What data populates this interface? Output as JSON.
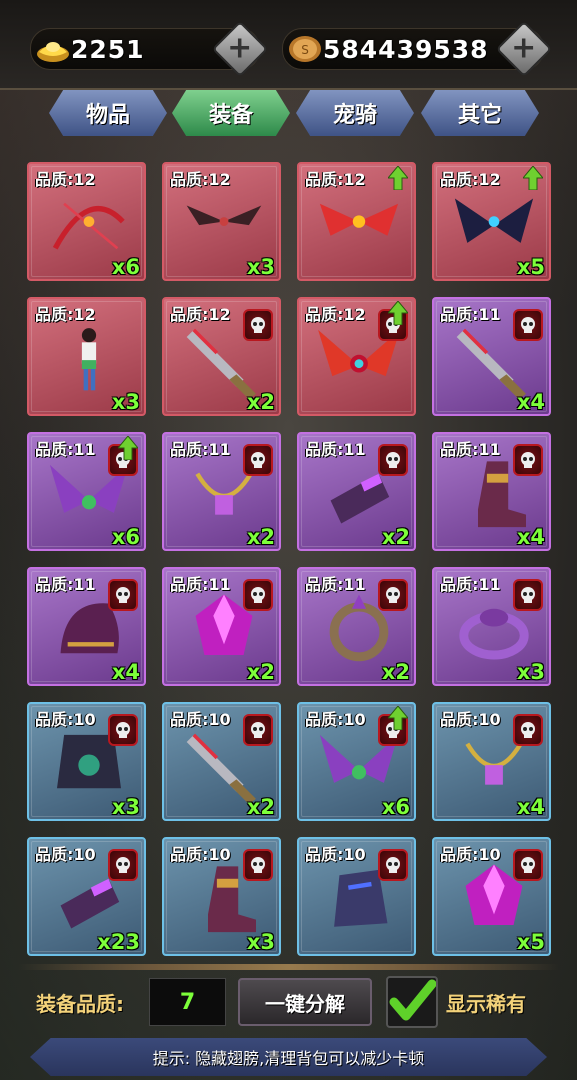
{
  "currency": {
    "gold_value": "2251",
    "coin_value": "584439538",
    "gold_icon": "gold-ingot-icon",
    "coin_icon": "copper-coin-icon",
    "plus_icon": "plus-icon"
  },
  "tabs": [
    {
      "label": "物品",
      "active": false
    },
    {
      "label": "装备",
      "active": true
    },
    {
      "label": "宠骑",
      "active": false
    },
    {
      "label": "其它",
      "active": false
    }
  ],
  "colors": {
    "red_quality": "#b84b59",
    "purple_quality": "#8a52ad",
    "blue_quality": "#4f7490",
    "count_green": "#7dff3a",
    "label_gold": "#f3d27a"
  },
  "items": [
    {
      "quality": "品质:12",
      "count": "x6",
      "rarity": "red",
      "art": "bow",
      "upgrade": false,
      "skull": false
    },
    {
      "quality": "品质:12",
      "count": "x3",
      "rarity": "red",
      "art": "wings-dark",
      "upgrade": false,
      "skull": false
    },
    {
      "quality": "品质:12",
      "count": "",
      "rarity": "red",
      "art": "wings-fire",
      "upgrade": true,
      "skull": false
    },
    {
      "quality": "品质:12",
      "count": "x5",
      "rarity": "red",
      "art": "wings-bat",
      "upgrade": true,
      "skull": false
    },
    {
      "quality": "品质:12",
      "count": "x3",
      "rarity": "red",
      "art": "figure",
      "upgrade": false,
      "skull": false
    },
    {
      "quality": "品质:12",
      "count": "x2",
      "rarity": "red",
      "art": "blade",
      "upgrade": false,
      "skull": true
    },
    {
      "quality": "品质:12",
      "count": "",
      "rarity": "red",
      "art": "wings-phoenix",
      "upgrade": true,
      "skull": true
    },
    {
      "quality": "品质:11",
      "count": "x4",
      "rarity": "purple",
      "art": "blade",
      "upgrade": false,
      "skull": true
    },
    {
      "quality": "品质:11",
      "count": "x6",
      "rarity": "purple",
      "art": "wings-feather",
      "upgrade": true,
      "skull": true
    },
    {
      "quality": "品质:11",
      "count": "x2",
      "rarity": "purple",
      "art": "necklace",
      "upgrade": false,
      "skull": true
    },
    {
      "quality": "品质:11",
      "count": "x2",
      "rarity": "purple",
      "art": "bracer",
      "upgrade": false,
      "skull": true
    },
    {
      "quality": "品质:11",
      "count": "x4",
      "rarity": "purple",
      "art": "boots",
      "upgrade": false,
      "skull": true
    },
    {
      "quality": "品质:11",
      "count": "x4",
      "rarity": "purple",
      "art": "helmet",
      "upgrade": false,
      "skull": true
    },
    {
      "quality": "品质:11",
      "count": "x2",
      "rarity": "purple",
      "art": "gem",
      "upgrade": false,
      "skull": true
    },
    {
      "quality": "品质:11",
      "count": "x2",
      "rarity": "purple",
      "art": "ring-spiked",
      "upgrade": false,
      "skull": true
    },
    {
      "quality": "品质:11",
      "count": "x3",
      "rarity": "purple",
      "art": "ring",
      "upgrade": false,
      "skull": true
    },
    {
      "quality": "品质:10",
      "count": "x3",
      "rarity": "blue",
      "art": "armor",
      "upgrade": false,
      "skull": true
    },
    {
      "quality": "品质:10",
      "count": "x2",
      "rarity": "blue",
      "art": "blade",
      "upgrade": false,
      "skull": true
    },
    {
      "quality": "品质:10",
      "count": "x6",
      "rarity": "blue",
      "art": "wings-feather",
      "upgrade": true,
      "skull": true
    },
    {
      "quality": "品质:10",
      "count": "x4",
      "rarity": "blue",
      "art": "necklace",
      "upgrade": false,
      "skull": true
    },
    {
      "quality": "品质:10",
      "count": "x23",
      "rarity": "blue",
      "art": "bracer",
      "upgrade": false,
      "skull": true
    },
    {
      "quality": "品质:10",
      "count": "x3",
      "rarity": "blue",
      "art": "boots",
      "upgrade": false,
      "skull": true
    },
    {
      "quality": "品质:10",
      "count": "",
      "rarity": "blue",
      "art": "gauntlet",
      "upgrade": false,
      "skull": true
    },
    {
      "quality": "品质:10",
      "count": "x5",
      "rarity": "blue",
      "art": "gem",
      "upgrade": false,
      "skull": true
    }
  ],
  "bottom": {
    "quality_label": "装备品质:",
    "quality_value": "7",
    "decompose_label": "一键分解",
    "show_rare_label": "显示稀有",
    "show_rare_checked": true,
    "tip": "提示: 隐藏翅膀,清理背包可以减少卡顿"
  }
}
